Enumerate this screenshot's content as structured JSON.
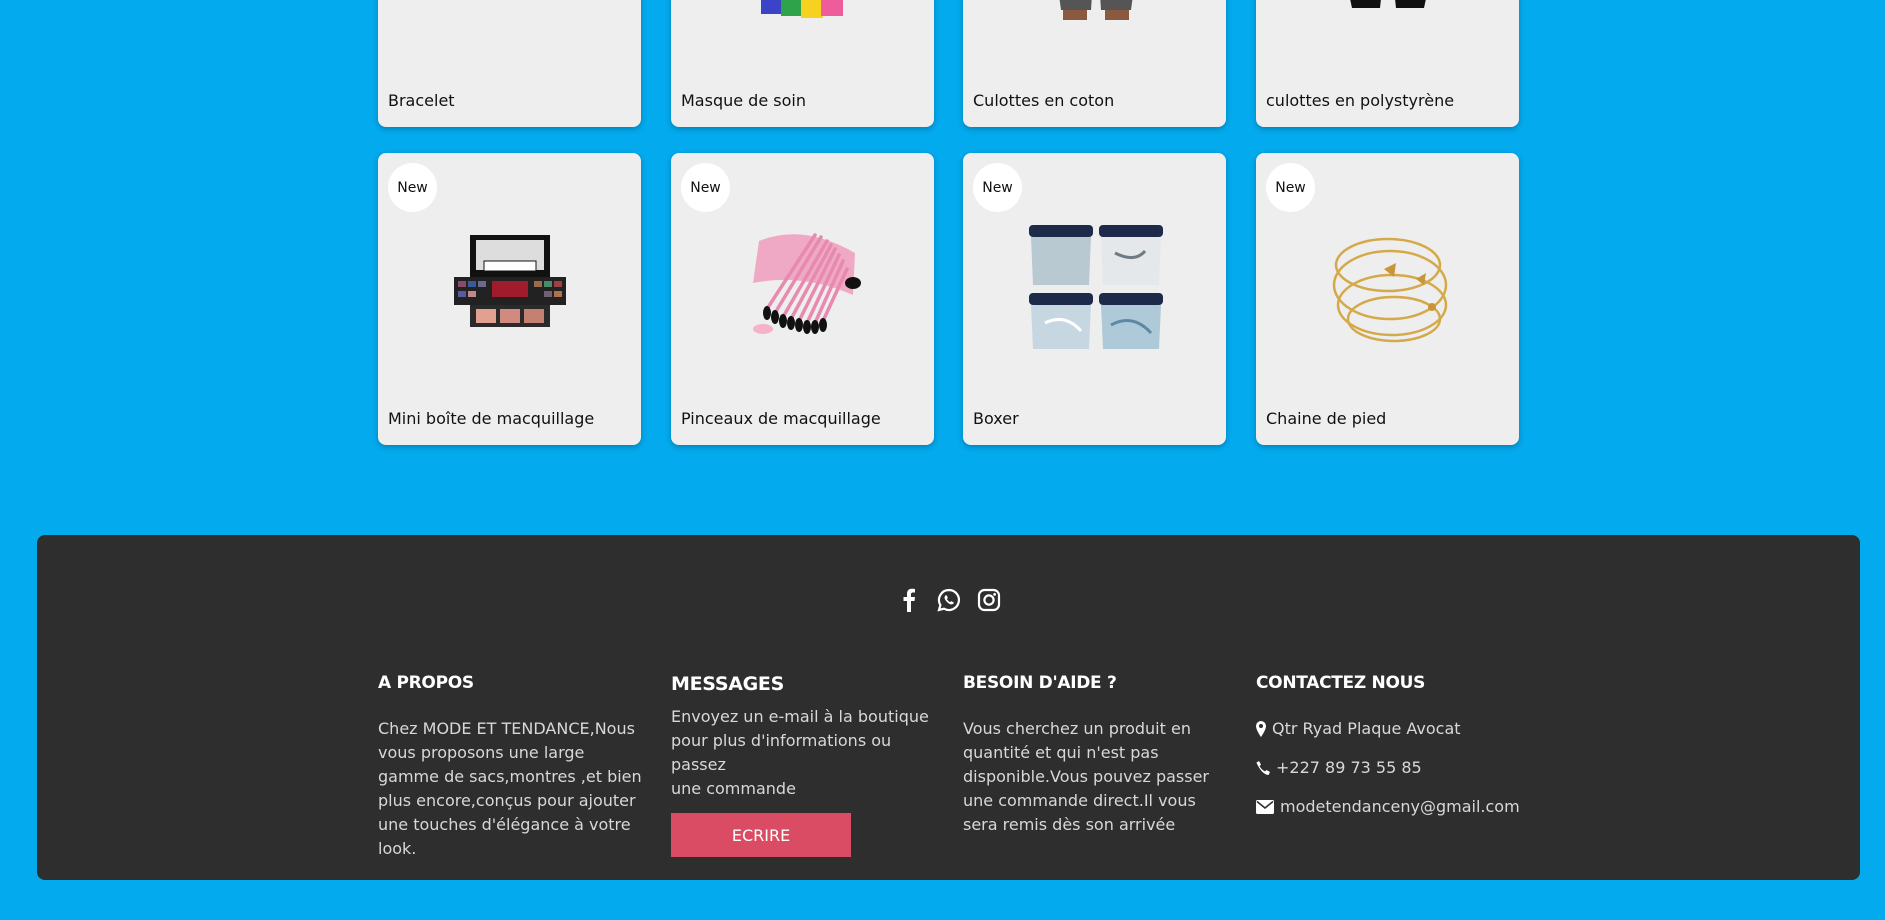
{
  "products_top": [
    {
      "name": "Bracelet"
    },
    {
      "name": "Masque de soin"
    },
    {
      "name": "Culottes en coton"
    },
    {
      "name": "culottes en polystyrène"
    }
  ],
  "products_bottom": [
    {
      "name": "Mini boîte de macquillage",
      "badge": "New"
    },
    {
      "name": "Pinceaux de macquillage",
      "badge": "New"
    },
    {
      "name": "Boxer",
      "badge": "New"
    },
    {
      "name": "Chaine de pied",
      "badge": "New"
    }
  ],
  "footer": {
    "social": [
      "facebook-icon",
      "whatsapp-icon",
      "instagram-icon"
    ],
    "about": {
      "title": "A PROPOS",
      "text": "Chez MODE ET TENDANCE,Nous vous proposons une large gamme de sacs,montres ,et bien plus encore,conçus pour ajouter une touches d'élégance à votre look."
    },
    "messages": {
      "title": "MESSAGES",
      "text_1": "Envoyez un e-mail à la boutique pour plus d'informations ou passez",
      "text_2": "une commande",
      "button": "ECRIRE"
    },
    "help": {
      "title": "BESOIN D'AIDE ?",
      "text": "Vous cherchez un produit en quantité et qui n'est pas disponible.Vous pouvez passer une commande direct.Il vous sera remis dès son arrivée"
    },
    "contact": {
      "title": "CONTACTEZ NOUS",
      "address": "Qtr Ryad Plaque Avocat",
      "phone": "+227 89 73 55 85",
      "email": "modetendanceny@gmail.com"
    }
  },
  "colors": {
    "page_background": "#03aaee",
    "footer_background": "#2e2e2e",
    "card_background": "#eeeeee",
    "button": "#d94c63"
  }
}
